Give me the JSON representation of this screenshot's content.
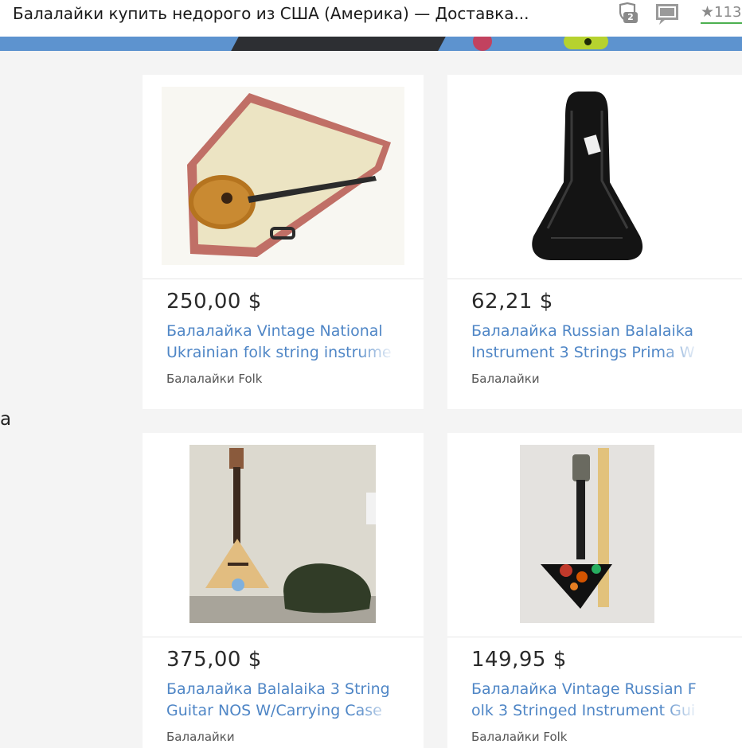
{
  "header": {
    "title": "Балалайки купить недорого из США (Америка) — Доставка...",
    "shield_badge": "2",
    "rating_count": "113"
  },
  "left_letter": "a",
  "products": [
    {
      "price": "250,00 $",
      "title": "Балалайка Vintage National Ukrainian folk string instrume",
      "category": "Балалайки Folk",
      "image_alt": "balalaika in open wooden case"
    },
    {
      "price": "62,21 $",
      "title": "Балалайка Russian Balalaika Instrument 3 Strings Prima Wo",
      "category": "Балалайки",
      "image_alt": "black balalaika gig bag"
    },
    {
      "price": "375,00 $",
      "title": "Балалайка Balalaika 3 String Guitar NOS W/Carrying Case B",
      "category": "Балалайки",
      "image_alt": "balalaika with green case"
    },
    {
      "price": "149,95 $",
      "title": "Балалайка Vintage Russian Folk 3 Stringed Instrument Guit",
      "category": "Балалайки Folk",
      "image_alt": "painted black balalaika with ruler"
    }
  ]
}
